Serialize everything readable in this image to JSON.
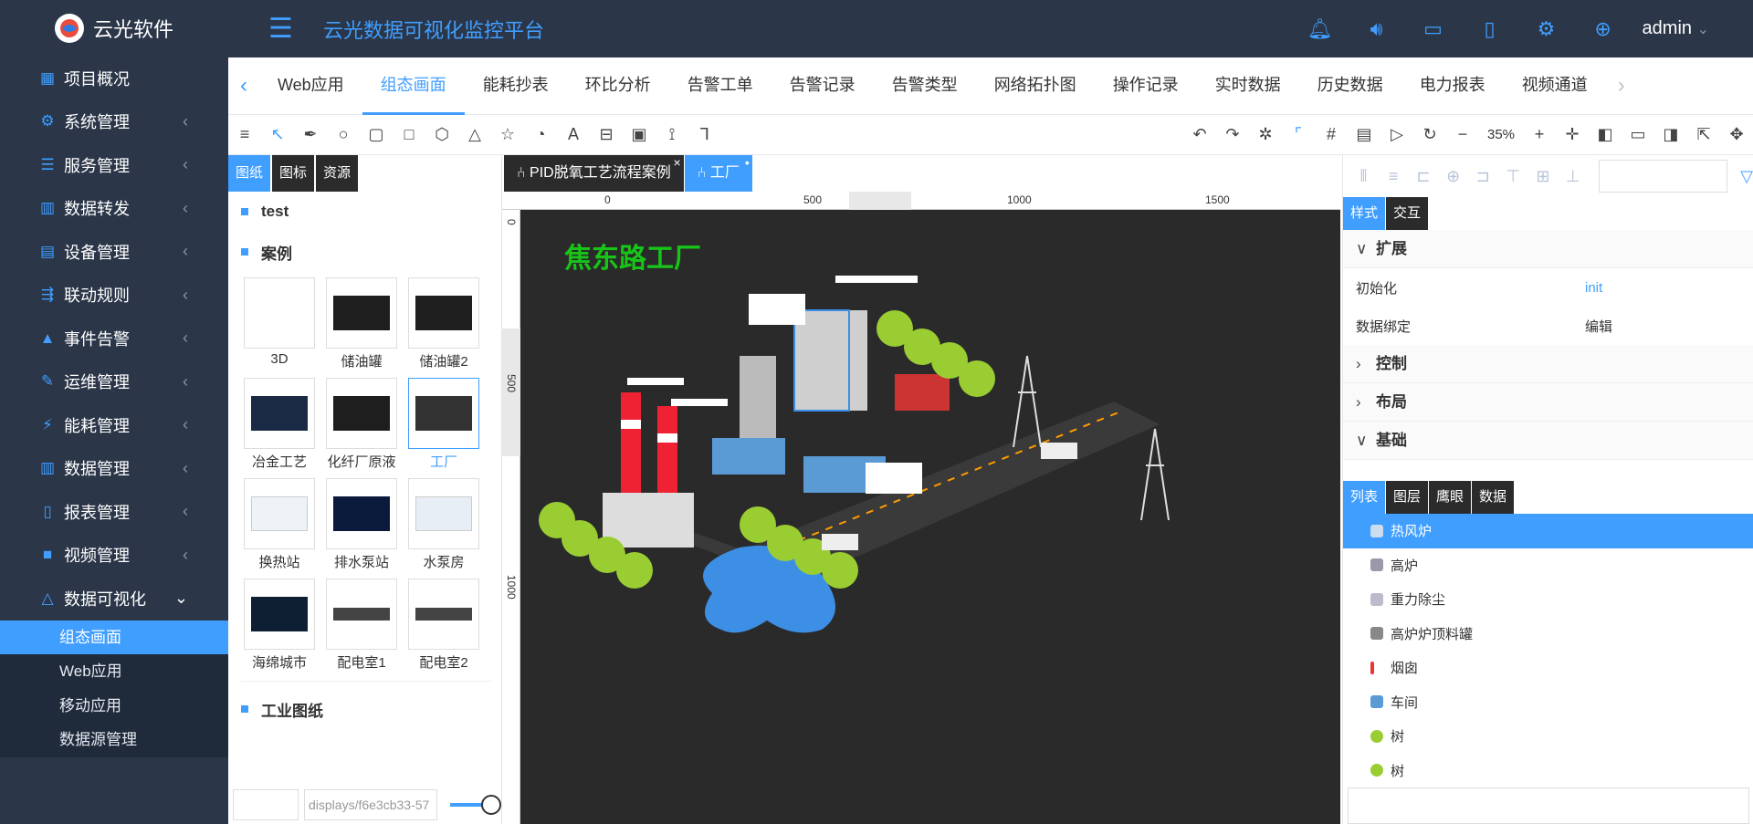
{
  "brand": {
    "name": "云光软件"
  },
  "sidebar": {
    "items": [
      {
        "label": "项目概况",
        "icon": "dashboard-icon"
      },
      {
        "label": "系统管理",
        "icon": "gear-icon"
      },
      {
        "label": "服务管理",
        "icon": "list-icon"
      },
      {
        "label": "数据转发",
        "icon": "columns-icon"
      },
      {
        "label": "设备管理",
        "icon": "server-icon"
      },
      {
        "label": "联动规则",
        "icon": "rules-icon"
      },
      {
        "label": "事件告警",
        "icon": "warning-icon"
      },
      {
        "label": "运维管理",
        "icon": "edit-icon"
      },
      {
        "label": "能耗管理",
        "icon": "energy-icon"
      },
      {
        "label": "数据管理",
        "icon": "columns-icon"
      },
      {
        "label": "报表管理",
        "icon": "document-icon"
      },
      {
        "label": "视频管理",
        "icon": "video-icon"
      },
      {
        "label": "数据可视化",
        "icon": "chart-icon"
      }
    ],
    "subitems": [
      "组态画面",
      "Web应用",
      "移动应用",
      "数据源管理"
    ]
  },
  "header": {
    "title": "云光数据可视化监控平台",
    "user": "admin"
  },
  "tabs": [
    "Web应用",
    "组态画面",
    "能耗抄表",
    "环比分析",
    "告警工单",
    "告警记录",
    "告警类型",
    "网络拓扑图",
    "操作记录",
    "实时数据",
    "历史数据",
    "电力报表",
    "视频通道"
  ],
  "toolbar": {
    "zoom": "35%"
  },
  "left": {
    "tabs": [
      "图纸",
      "图标",
      "资源"
    ],
    "sections": [
      "test",
      "案例",
      "工业图纸"
    ],
    "thumbs": [
      "3D",
      "储油罐",
      "储油罐2",
      "冶金工艺",
      "化纤厂原液",
      "工厂",
      "换热站",
      "排水泵站",
      "水泵房",
      "海绵城市",
      "配电室1",
      "配电室2"
    ],
    "path": "displays/f6e3cb33-57"
  },
  "canvas": {
    "tabs": [
      "PID脱氧工艺流程案例",
      "工厂"
    ],
    "ruler": [
      "0",
      "500",
      "1000",
      "1500"
    ],
    "vruler": [
      "0",
      "500",
      "1000"
    ],
    "title": "焦东路工厂"
  },
  "right": {
    "tabs": [
      "样式",
      "交互"
    ],
    "groups": [
      "扩展",
      "控制",
      "布局",
      "基础"
    ],
    "props": [
      {
        "k": "初始化",
        "v": "init"
      },
      {
        "k": "数据绑定",
        "v": "编辑"
      }
    ],
    "listTabs": [
      "列表",
      "图层",
      "鹰眼",
      "数据"
    ],
    "list": [
      "热风炉",
      "高炉",
      "重力除尘",
      "高炉炉顶料罐",
      "烟囱",
      "车间",
      "树",
      "树"
    ]
  }
}
